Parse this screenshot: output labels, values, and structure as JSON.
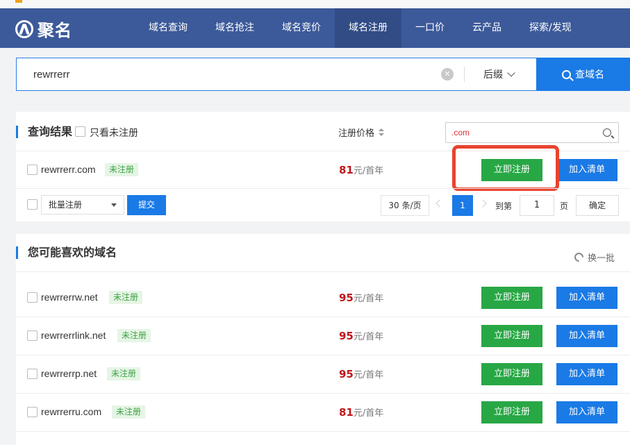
{
  "brand": {
    "name": "聚名"
  },
  "nav": [
    "域名查询",
    "域名抢注",
    "域名竞价",
    "域名注册",
    "一口价",
    "云产品",
    "探索/发现"
  ],
  "search": {
    "value": "rewrrerr",
    "suffix_label": "后缀",
    "button_label": "查域名"
  },
  "results": {
    "title": "查询结果",
    "only_unregistered_label": "只看未注册",
    "price_header": "注册价格",
    "filter_value": ".com",
    "rows": [
      {
        "domain": "rewrrerr.com",
        "status": "未注册",
        "price": "81",
        "unit": "元/首年",
        "register_label": "立即注册",
        "add_label": "加入清单"
      }
    ],
    "bulk_label": "批量注册",
    "submit_label": "提交",
    "page_size": "30 条/页",
    "current_page": "1",
    "goto_label": "到第",
    "goto_value": "1",
    "page_label": "页",
    "confirm_label": "确定"
  },
  "suggestions": {
    "title": "您可能喜欢的域名",
    "refresh_label": "换一批",
    "rows": [
      {
        "domain": "rewrrerrw.net",
        "status": "未注册",
        "price": "95",
        "unit": "元/首年",
        "register_label": "立即注册",
        "add_label": "加入清单"
      },
      {
        "domain": "rewrrerrlink.net",
        "status": "未注册",
        "price": "95",
        "unit": "元/首年",
        "register_label": "立即注册",
        "add_label": "加入清单"
      },
      {
        "domain": "rewrrerrp.net",
        "status": "未注册",
        "price": "95",
        "unit": "元/首年",
        "register_label": "立即注册",
        "add_label": "加入清单"
      },
      {
        "domain": "rewrrerru.com",
        "status": "未注册",
        "price": "81",
        "unit": "元/首年",
        "register_label": "立即注册",
        "add_label": "加入清单"
      }
    ]
  },
  "colors": {
    "header": "#3c5a9a",
    "primary": "#1a7ae6",
    "register": "#28a745",
    "price": "#c0171b",
    "highlight": "#e8432d"
  }
}
